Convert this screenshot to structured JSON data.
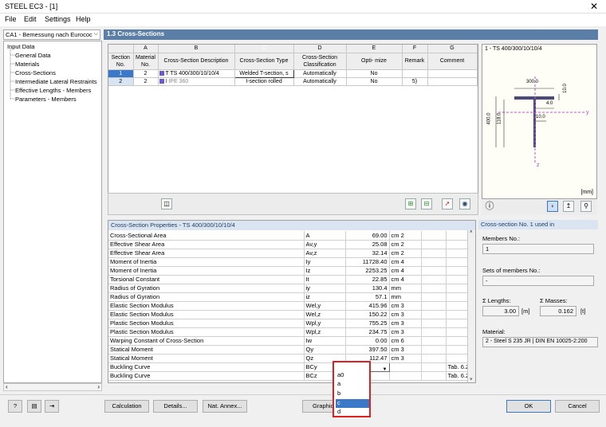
{
  "window": {
    "title": "STEEL EC3 - [1]",
    "close": "✕"
  },
  "menu": [
    "File",
    "Edit",
    "Settings",
    "Help"
  ],
  "case_combo": "CA1 - Bemessung nach Eurococ",
  "nav": {
    "root": "Input Data",
    "items": [
      "General Data",
      "Materials",
      "Cross-Sections",
      "Intermediate Lateral Restraints",
      "Effective Lengths - Members",
      "Parameters - Members"
    ]
  },
  "panel_title": "1.3 Cross-Sections",
  "grid": {
    "letters": [
      "A",
      "B",
      "C",
      "D",
      "E",
      "F",
      "G"
    ],
    "row_header_label": "Section No.",
    "headers": [
      "Material No.",
      "Cross-Section Description",
      "Cross-Section Type",
      "Cross-Section Classification",
      "Opti- mize",
      "Remark",
      "Comment"
    ],
    "rows": [
      {
        "no": "1",
        "material": "2",
        "description": "TS 400/300/10/10/4",
        "type": "Welded T-section, s",
        "classification": "Automatically",
        "optimize": "No",
        "remark": "",
        "comment": ""
      },
      {
        "no": "2",
        "material": "2",
        "description": "IPE 360",
        "type": "I-section rolled",
        "classification": "Automatically",
        "optimize": "No",
        "remark": "5)",
        "comment": ""
      }
    ]
  },
  "preview": {
    "title": "1 - TS 400/300/10/10/4",
    "dims": {
      "flange_width": "300.0",
      "flange_thk": "10.0",
      "web_thk": "4.0",
      "height": "400.0",
      "web_height": "118.0",
      "web_offset": "10.0"
    },
    "axes": {
      "y": "y",
      "z": "z"
    },
    "unit": "[mm]"
  },
  "properties": {
    "title": "Cross-Section Properties  -  TS 400/300/10/10/4",
    "rows": [
      {
        "name": "Cross-Sectional Area",
        "symbol": "A",
        "value": "69.00",
        "unit": "cm 2",
        "note": ""
      },
      {
        "name": "Effective Shear Area",
        "symbol": "Av,y",
        "value": "25.08",
        "unit": "cm 2",
        "note": ""
      },
      {
        "name": "Effective Shear Area",
        "symbol": "Av,z",
        "value": "32.14",
        "unit": "cm 2",
        "note": ""
      },
      {
        "name": "Moment of Inertia",
        "symbol": "Iy",
        "value": "11728.40",
        "unit": "cm 4",
        "note": ""
      },
      {
        "name": "Moment of Inertia",
        "symbol": "Iz",
        "value": "2253.25",
        "unit": "cm 4",
        "note": ""
      },
      {
        "name": "Torsional Constant",
        "symbol": "It",
        "value": "22.85",
        "unit": "cm 4",
        "note": ""
      },
      {
        "name": "Radius of Gyration",
        "symbol": "iy",
        "value": "130.4",
        "unit": "mm",
        "note": ""
      },
      {
        "name": "Radius of Gyration",
        "symbol": "iz",
        "value": "57.1",
        "unit": "mm",
        "note": ""
      },
      {
        "name": "Elastic Section Modulus",
        "symbol": "Wel,y",
        "value": "415.96",
        "unit": "cm 3",
        "note": ""
      },
      {
        "name": "Elastic Section Modulus",
        "symbol": "Wel,z",
        "value": "150.22",
        "unit": "cm 3",
        "note": ""
      },
      {
        "name": "Plastic Section Modulus",
        "symbol": "Wpl,y",
        "value": "755.25",
        "unit": "cm 3",
        "note": ""
      },
      {
        "name": "Plastic Section Modulus",
        "symbol": "Wpl,z",
        "value": "234.75",
        "unit": "cm 3",
        "note": ""
      },
      {
        "name": "Warping Constant of Cross-Section",
        "symbol": "Iw",
        "value": "0.00",
        "unit": "cm 6",
        "note": ""
      },
      {
        "name": "Statical Moment",
        "symbol": "Qy",
        "value": "397.50",
        "unit": "cm 3",
        "note": ""
      },
      {
        "name": "Statical Moment",
        "symbol": "Qz",
        "value": "112.47",
        "unit": "cm 3",
        "note": ""
      },
      {
        "name": "Buckling Curve",
        "symbol": "BCy",
        "value": "c",
        "unit": "",
        "note": "Tab. 6.2"
      },
      {
        "name": "Buckling Curve",
        "symbol": "BCz",
        "value": "",
        "unit": "",
        "note": "Tab. 6.2"
      }
    ],
    "dropdown_options": [
      "a0",
      "a",
      "b",
      "c",
      "d"
    ],
    "dropdown_selected": "c"
  },
  "side": {
    "title": "Cross-section No. 1 used in",
    "members_label": "Members No.:",
    "members_value": "1",
    "sets_label": "Sets of members No.:",
    "sets_value": "-",
    "lengths_label": "Σ Lengths:",
    "lengths_value": "3.00",
    "lengths_unit": "[m]",
    "masses_label": "Σ Masses:",
    "masses_value": "0.162",
    "masses_unit": "[t]",
    "material_label": "Material:",
    "material_value": "2 - Steel S 235 JR | DIN EN 10025-2:200"
  },
  "buttons": {
    "calculation": "Calculation",
    "details": "Details...",
    "nat_annex": "Nat. Annex...",
    "graphics": "Graphics",
    "ok": "OK",
    "cancel": "Cancel"
  }
}
